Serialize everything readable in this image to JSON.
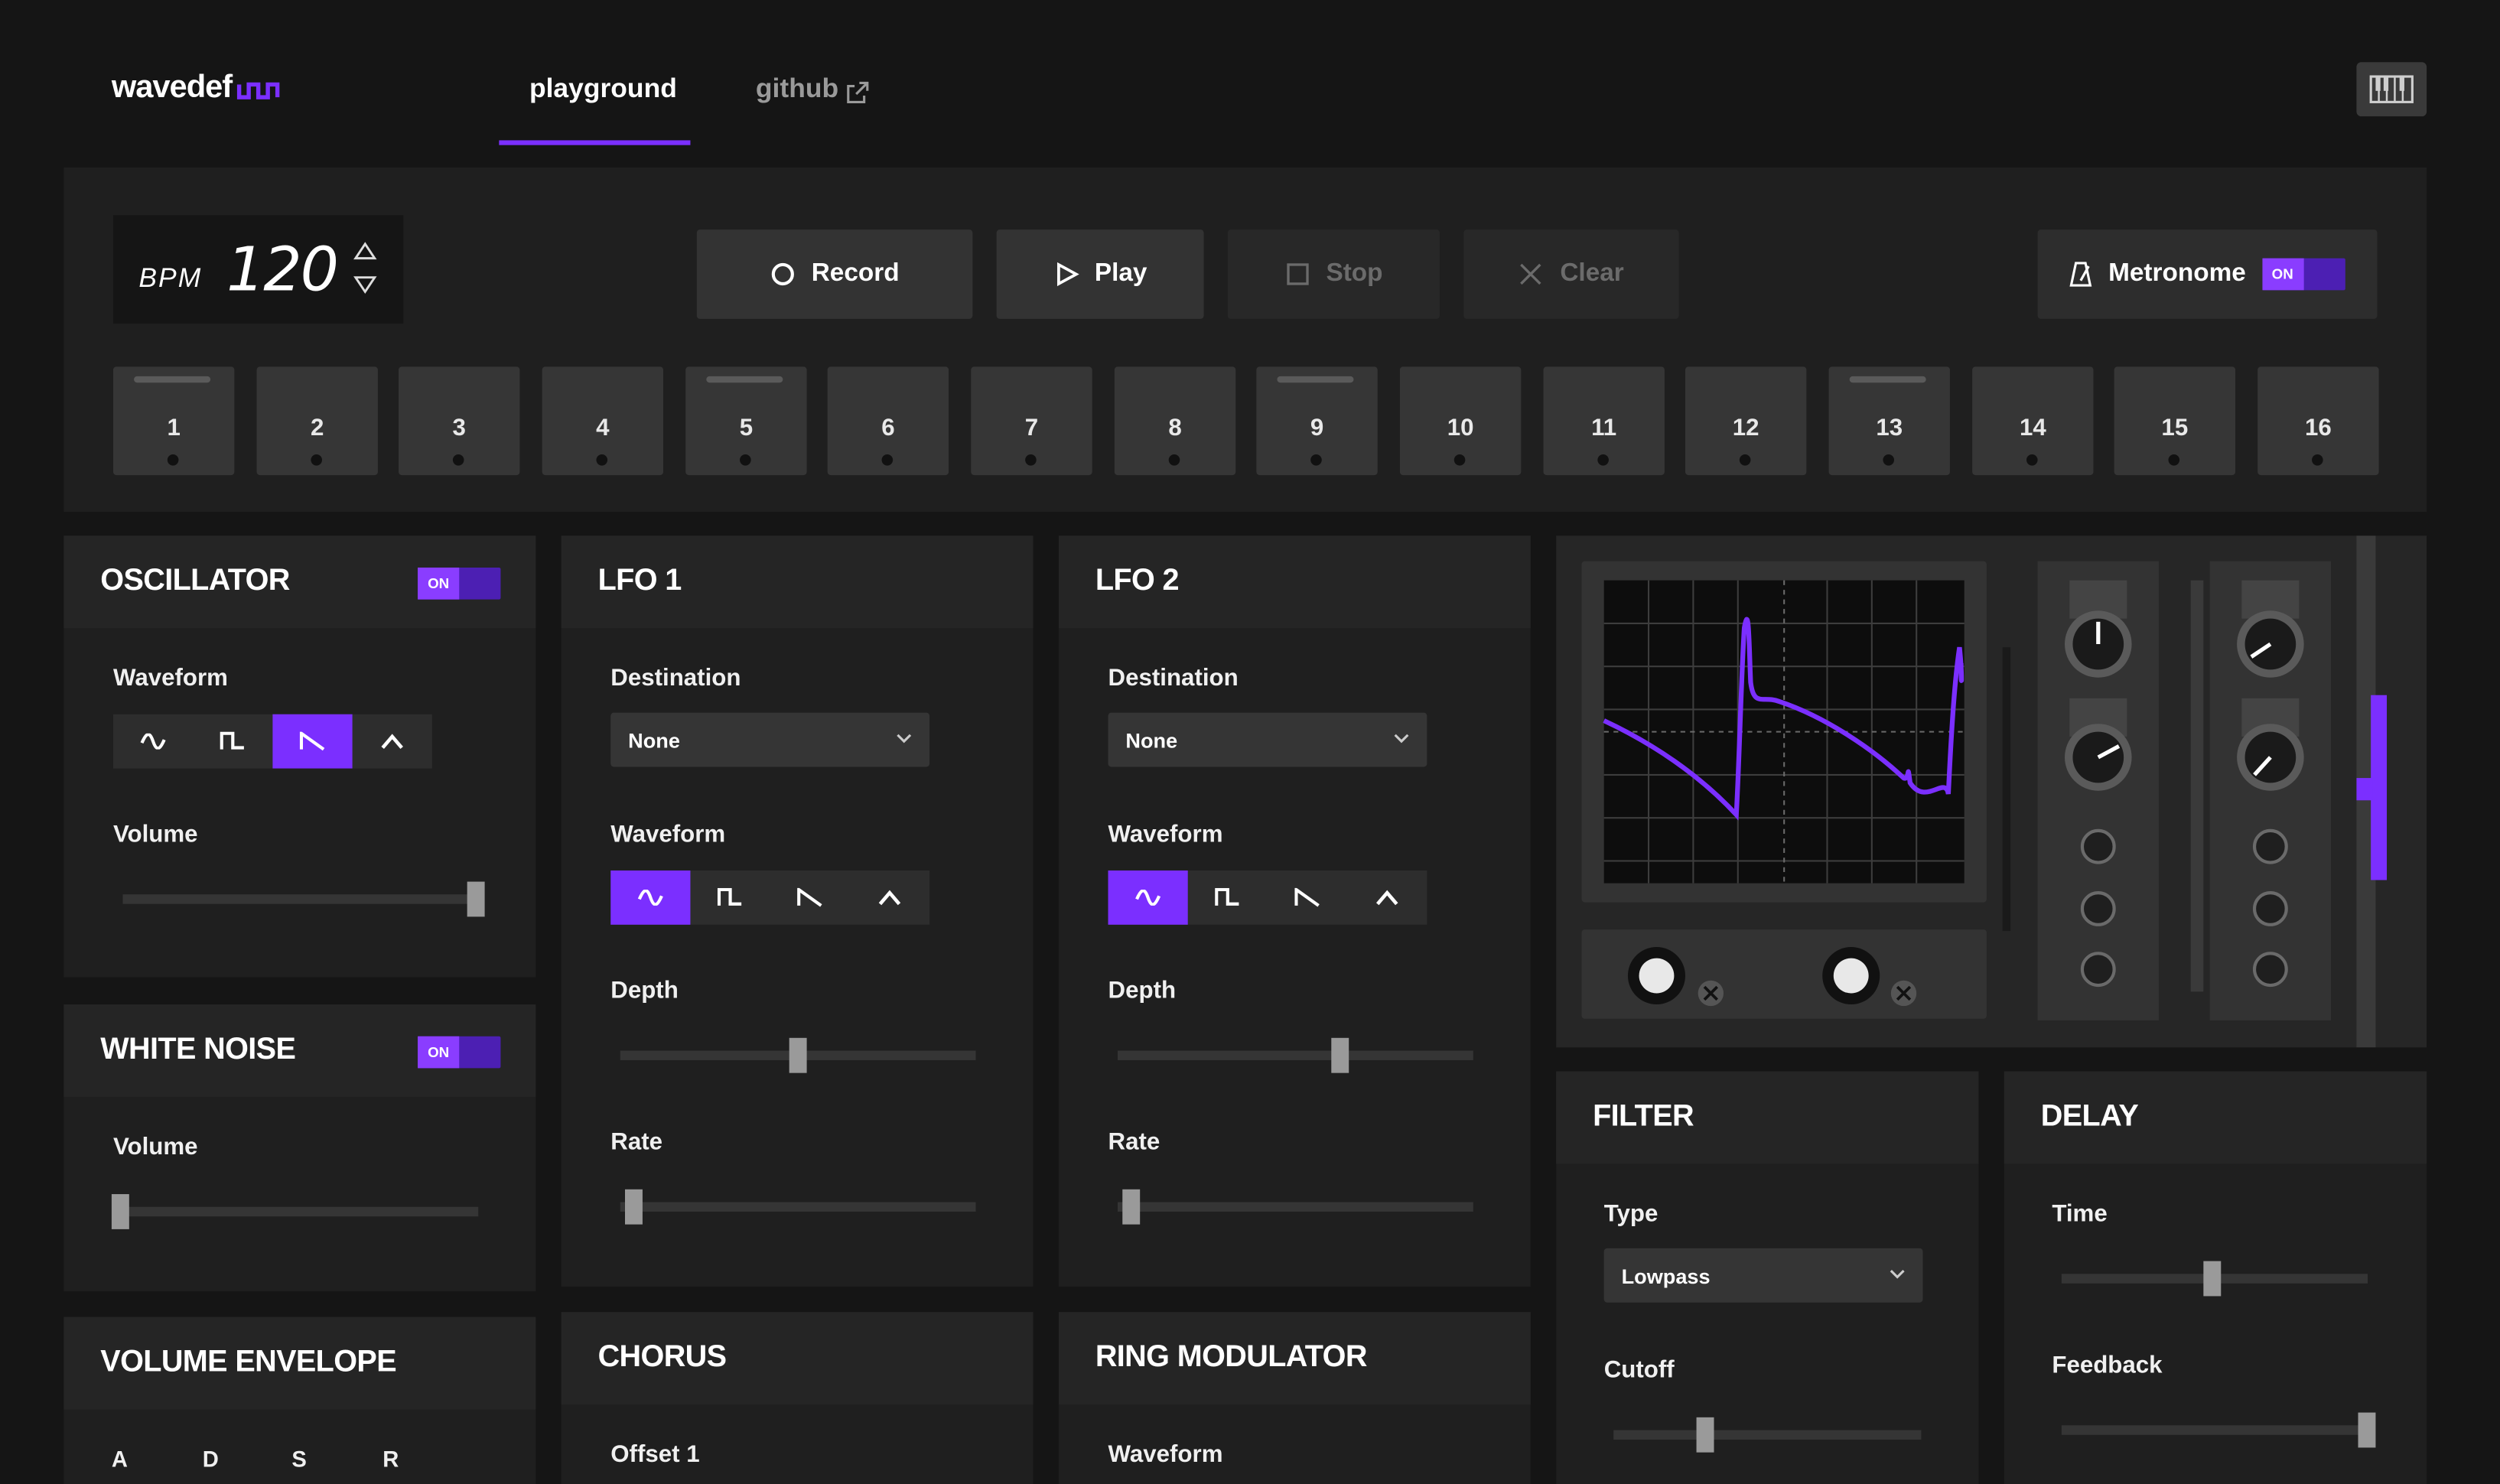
{
  "header": {
    "logo": "wavedef",
    "tabs": [
      {
        "label": "playground",
        "active": true
      },
      {
        "label": "github",
        "active": false
      }
    ],
    "accent": "#7b2fff",
    "keyboard_icon": "piano-keyboard-icon"
  },
  "transport": {
    "bpm_label": "BPM",
    "bpm_value": "120",
    "record_label": "Record",
    "play_label": "Play",
    "stop_label": "Stop",
    "clear_label": "Clear",
    "metronome_label": "Metronome",
    "metronome_state": "ON",
    "steps": [
      "1",
      "2",
      "3",
      "4",
      "5",
      "6",
      "7",
      "8",
      "9",
      "10",
      "11",
      "12",
      "13",
      "14",
      "15",
      "16"
    ]
  },
  "oscillator": {
    "title": "OSCILLATOR",
    "state": "ON",
    "waveform_label": "Waveform",
    "waveform_selected": "sawtooth",
    "volume_label": "Volume",
    "volume_level": 1.0
  },
  "white_noise": {
    "title": "WHITE NOISE",
    "state": "ON",
    "volume_label": "Volume",
    "volume_level": 0.0
  },
  "volume_envelope": {
    "title": "VOLUME ENVELOPE",
    "params": [
      "A",
      "D",
      "S",
      "R"
    ]
  },
  "lfo1": {
    "title": "LFO 1",
    "destination_label": "Destination",
    "destination_value": "None",
    "waveform_label": "Waveform",
    "waveform_selected": "sine",
    "depth_label": "Depth",
    "depth_level": 0.5,
    "rate_label": "Rate",
    "rate_level": 0.03
  },
  "lfo2": {
    "title": "LFO 2",
    "destination_label": "Destination",
    "destination_value": "None",
    "waveform_label": "Waveform",
    "waveform_selected": "sine",
    "depth_label": "Depth",
    "depth_level": 0.63,
    "rate_label": "Rate",
    "rate_level": 0.03
  },
  "chorus": {
    "title": "CHORUS",
    "offset_label": "Offset 1"
  },
  "ring_modulator": {
    "title": "RING MODULATOR",
    "waveform_label": "Waveform"
  },
  "filter": {
    "title": "FILTER",
    "type_label": "Type",
    "type_value": "Lowpass",
    "cutoff_label": "Cutoff",
    "cutoff_level": 0.29
  },
  "delay": {
    "title": "DELAY",
    "time_label": "Time",
    "time_level": 0.49,
    "feedback_label": "Feedback",
    "feedback_level": 1.0
  }
}
